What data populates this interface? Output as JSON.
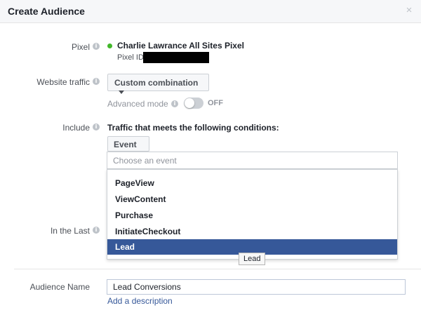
{
  "dialog": {
    "title": "Create Audience",
    "close_glyph": "×"
  },
  "pixel": {
    "label": "Pixel",
    "name": "Charlie Lawrance All Sites Pixel",
    "id_label": "Pixel ID",
    "status_color": "#42b72a"
  },
  "website_traffic": {
    "label": "Website traffic",
    "selected": "Custom combination",
    "advanced_mode_label": "Advanced mode",
    "toggle_state": "OFF"
  },
  "include": {
    "label": "Include",
    "description": "Traffic that meets the following conditions:",
    "type_selected": "Event",
    "event_placeholder": "Choose an event",
    "options": [
      "PageView",
      "ViewContent",
      "Purchase",
      "InitiateCheckout",
      "Lead"
    ],
    "highlighted_option": "Lead",
    "tooltip": "Lead"
  },
  "in_the_last": {
    "label": "In the Last"
  },
  "audience_name": {
    "label": "Audience Name",
    "value": "Lead Conversions",
    "add_description_link": "Add a description"
  },
  "colors": {
    "accent": "#365899",
    "header_bg": "#f6f7f9",
    "icon_gray": "#bec3c9"
  },
  "icons": {
    "info": "info-icon",
    "close": "close-icon",
    "caret": "chevron-down-icon"
  }
}
